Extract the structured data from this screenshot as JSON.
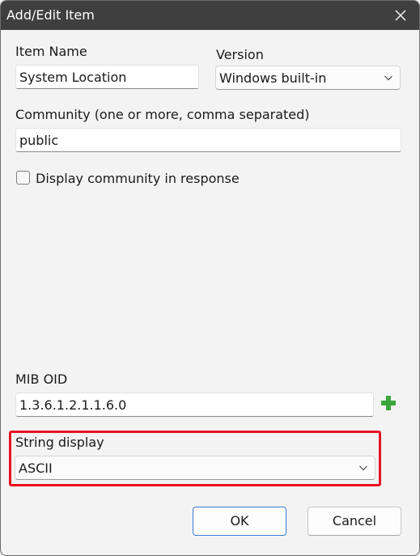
{
  "window": {
    "title": "Add/Edit Item"
  },
  "item_name": {
    "label": "Item Name",
    "value": "System Location"
  },
  "version": {
    "label": "Version",
    "selected": "Windows built-in"
  },
  "community": {
    "label": "Community (one or more, comma separated)",
    "value": "public"
  },
  "display_community": {
    "label": "Display community in response",
    "checked": false
  },
  "mib_oid": {
    "label": "MIB OID",
    "value": "1.3.6.1.2.1.1.6.0"
  },
  "string_display": {
    "label": "String display",
    "selected": "ASCII"
  },
  "buttons": {
    "ok": "OK",
    "cancel": "Cancel"
  },
  "colors": {
    "titlebar": "#3f3f3f",
    "highlight": "#e81123",
    "add_icon": "#3aa63a",
    "ok_border": "#3a7bd5"
  },
  "icons": {
    "close": "close-icon",
    "add": "plus-icon",
    "dropdown": "chevron-down-icon"
  }
}
